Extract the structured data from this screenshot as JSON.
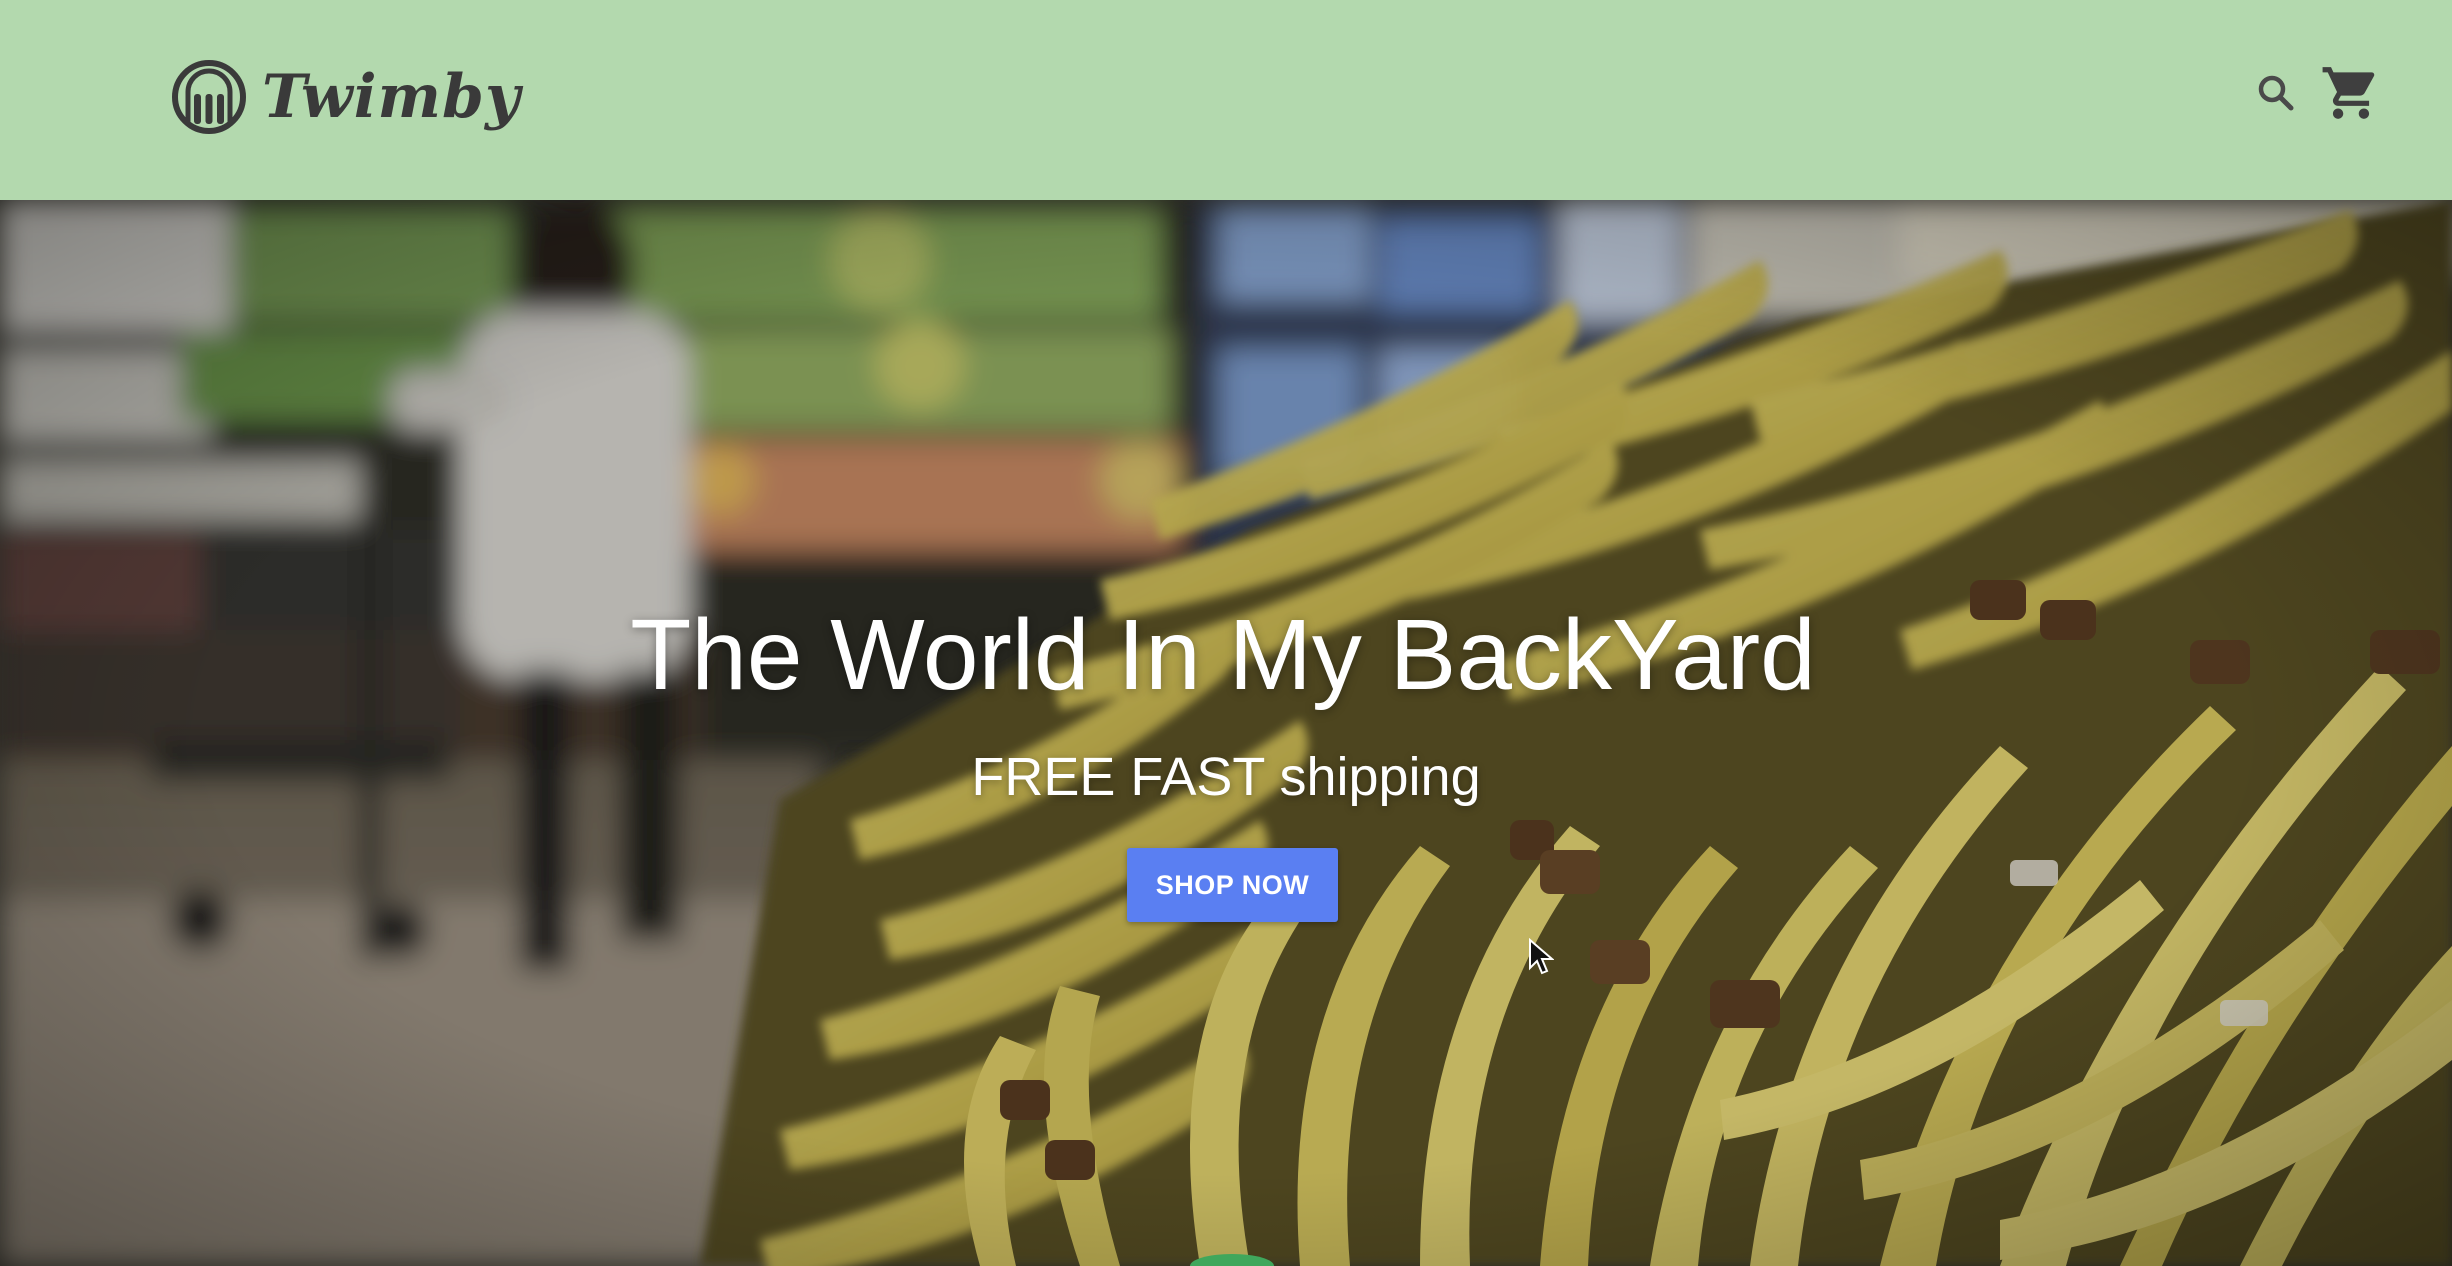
{
  "header": {
    "brand": "Twimby",
    "search_icon": "search-icon",
    "cart_icon": "cart-icon"
  },
  "hero": {
    "title": "The World In My BackYard",
    "subtitle": "FREE FAST shipping",
    "cta_label": "SHOP NOW",
    "background": "blurred grocery store with bananas"
  },
  "colors": {
    "header_bg": "#b3d9ae",
    "brand_text": "#3a3a3a",
    "cta_bg": "#5a7ff2",
    "hero_text": "#ffffff"
  }
}
